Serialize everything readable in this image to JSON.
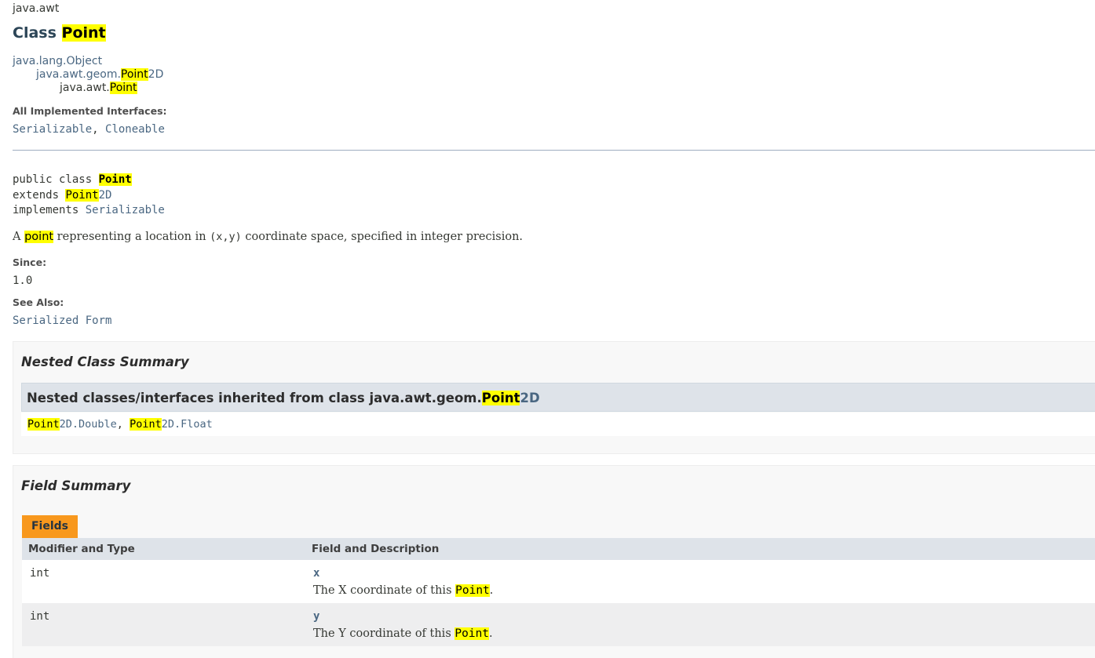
{
  "package_name": "java.awt",
  "class_title_prefix": "Class ",
  "class_name": "Point",
  "inheritance": {
    "level1": "java.lang.Object",
    "level2_prefix": "java.awt.geom.",
    "level2_hl": "Point",
    "level2_suffix": "2D",
    "level3_prefix": "java.awt.",
    "level3_hl": "Point"
  },
  "interfaces": {
    "label": "All Implemented Interfaces:",
    "item1": "Serializable",
    "separator": ", ",
    "item2": "Cloneable"
  },
  "signature": {
    "line1_prefix": "public class ",
    "line1_hl": "Point",
    "line2_prefix": "extends ",
    "line2_hl": "Point",
    "line2_link_suffix": "2D",
    "line3_prefix": "implements ",
    "line3_link": "Serializable"
  },
  "description": {
    "prefix": "A ",
    "hl": "point",
    "middle": " representing a location in ",
    "code": "(x,y)",
    "suffix": " coordinate space, specified in integer precision."
  },
  "since": {
    "label": "Since:",
    "value": "1.0"
  },
  "see_also": {
    "label": "See Also:",
    "link": "Serialized Form"
  },
  "nested": {
    "title": "Nested Class Summary",
    "inherited_prefix": "Nested classes/interfaces inherited from class java.awt.geom.",
    "inherited_hl": "Point",
    "inherited_suffix": "2D",
    "item1_hl": "Point",
    "item1_rest": "2D.Double",
    "sep": ", ",
    "item2_hl": "Point",
    "item2_rest": "2D.Float"
  },
  "field_summary": {
    "title": "Field Summary",
    "tab_label": "Fields",
    "col_modifier": "Modifier and Type",
    "col_field": "Field and Description",
    "rows": [
      {
        "type": "int",
        "name": "x",
        "desc_prefix": "The X coordinate of this ",
        "desc_hl": "Point",
        "desc_suffix": "."
      },
      {
        "type": "int",
        "name": "y",
        "desc_prefix": "The Y coordinate of this ",
        "desc_hl": "Point",
        "desc_suffix": "."
      }
    ]
  }
}
